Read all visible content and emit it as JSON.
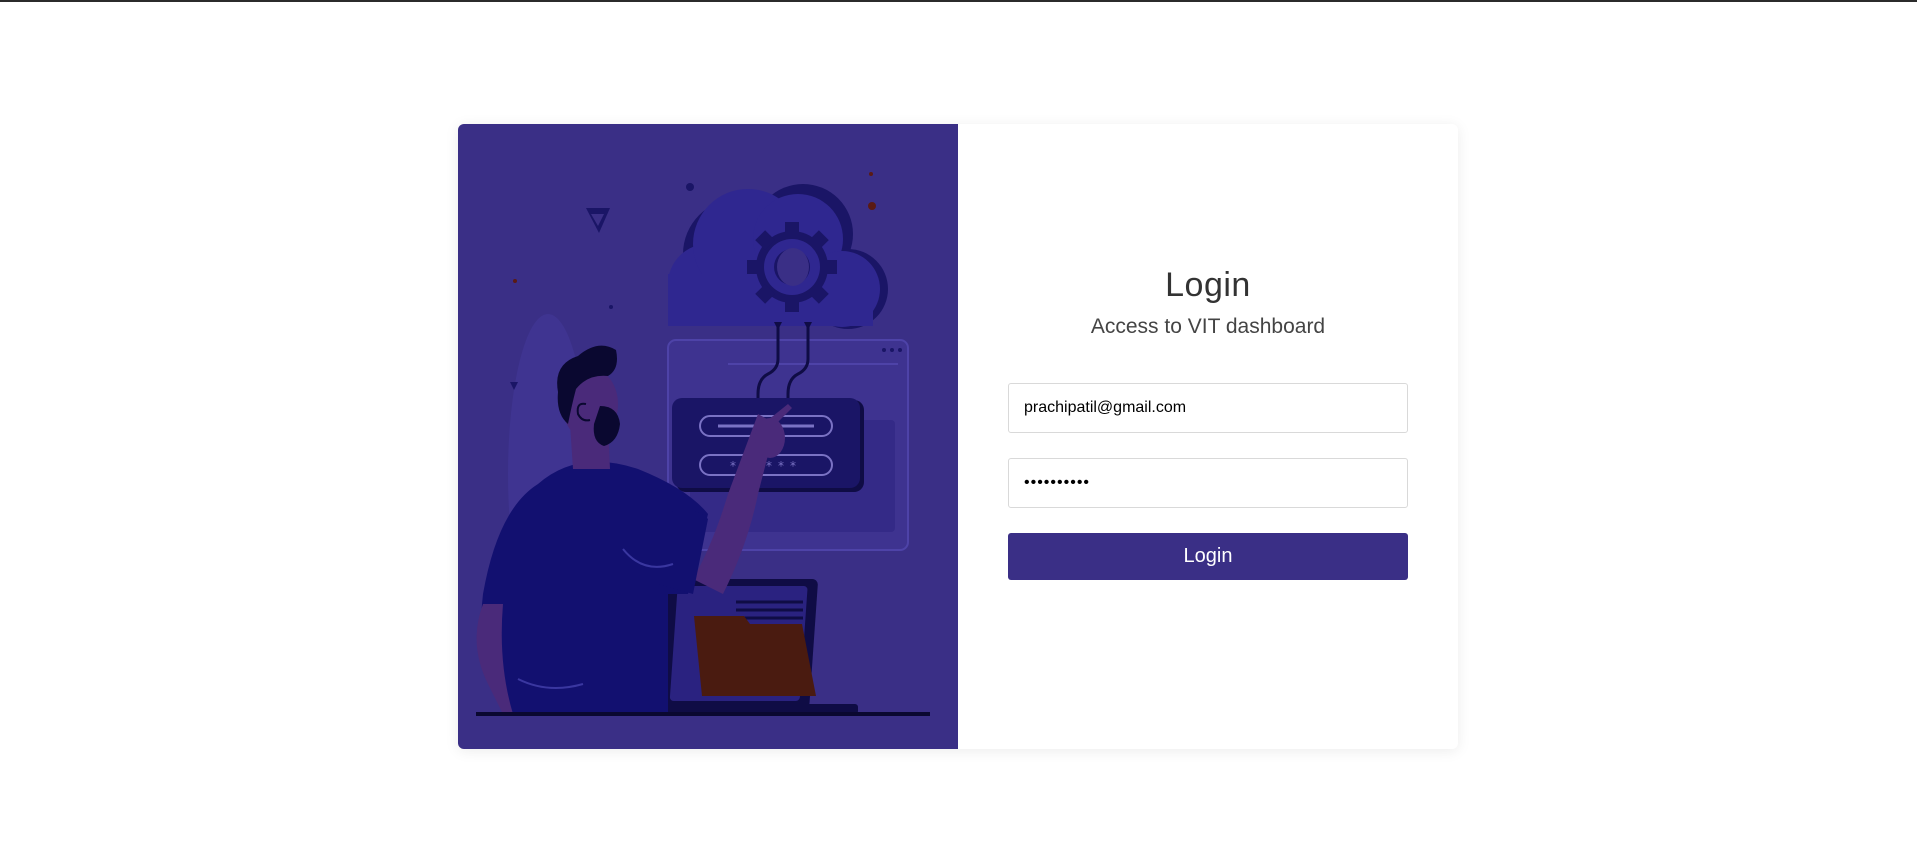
{
  "form": {
    "title": "Login",
    "subtitle": "Access to VIT dashboard",
    "email_value": "prachipatil@gmail.com",
    "password_value": "••••••••••",
    "login_label": "Login"
  },
  "colors": {
    "brand": "#3a2f86",
    "panel_background": "#3a2f86",
    "title_text": "#333333"
  },
  "icons": {
    "illustration": "person-cloud-login-illustration"
  }
}
